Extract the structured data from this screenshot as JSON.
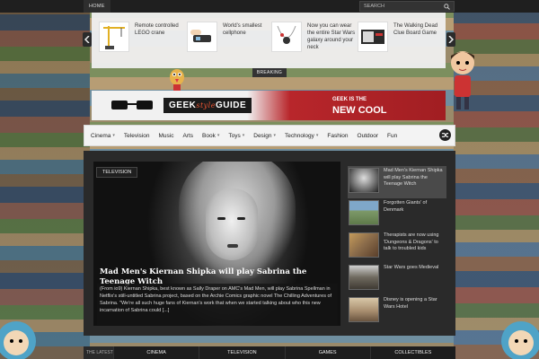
{
  "topbar": {
    "home": "HOME",
    "search_placeholder": "SEARCH"
  },
  "breaking": {
    "label": "BREAKING",
    "items": [
      {
        "text": "Remote controlled LEGO crane"
      },
      {
        "text": "World’s smallest cellphone"
      },
      {
        "text": "Now you can wear the entire Star Wars galaxy around your neck"
      },
      {
        "text": "The Walking Dead Clue Board Game"
      }
    ]
  },
  "banner": {
    "geek_style_guide_prefix": "GEEK",
    "geek_style_guide_mid": "style",
    "geek_style_guide_suffix": "GUIDE",
    "slogan_line1": "GEEK IS THE",
    "slogan_line2": "NEW COOL"
  },
  "nav": {
    "items": [
      {
        "label": "Cinema",
        "dropdown": true
      },
      {
        "label": "Television",
        "dropdown": false
      },
      {
        "label": "Music",
        "dropdown": false
      },
      {
        "label": "Arts",
        "dropdown": false
      },
      {
        "label": "Book",
        "dropdown": true
      },
      {
        "label": "Toys",
        "dropdown": true
      },
      {
        "label": "Design",
        "dropdown": true
      },
      {
        "label": "Technology",
        "dropdown": true
      },
      {
        "label": "Fashion",
        "dropdown": false
      },
      {
        "label": "Outdoor",
        "dropdown": false
      },
      {
        "label": "Fun",
        "dropdown": false
      }
    ]
  },
  "featured": {
    "category": "TELEVISION",
    "title": "Mad Men's Kiernan Shipka will play Sabrina the Teenage Witch",
    "excerpt": "(From io9) Kiernan Shipka, best known as Sally Draper on AMC's Mad Men, will play Sabrina Spellman in Netflix's still-untitled Sabrina project, based on the Archie Comics graphic novel The Chilling Adventures of Sabrina. \"We're all such huge fans of Kiernan's work that when we started talking about who this new incarnation of Sabrina could [...]"
  },
  "sidebar": {
    "items": [
      {
        "title": "Mad Men's Kiernan Shipka will play Sabrina the Teenage Witch",
        "thumb_color": "#9a9a9a"
      },
      {
        "title": "Forgotten Giants' of Denmark",
        "thumb_color": "#7f9a6a"
      },
      {
        "title": "Therapists are now using 'Dungeons & Dragons' to talk to troubled kids",
        "thumb_color": "#8a6b4a"
      },
      {
        "title": "Star Wars goes Medieval",
        "thumb_color": "#6f6a5f"
      },
      {
        "title": "Disney is opening a Star Wars Hotel",
        "thumb_color": "#a98f70"
      }
    ]
  },
  "bottom_tabs": {
    "latest": "THE LATEST",
    "tabs": [
      "CINEMA",
      "TELEVISION",
      "GAMES",
      "COLLECTIBLES"
    ]
  },
  "colors": {
    "accent": "#b8262b",
    "dark": "#2a2a2a",
    "nav_bg": "#f3f3f3"
  }
}
